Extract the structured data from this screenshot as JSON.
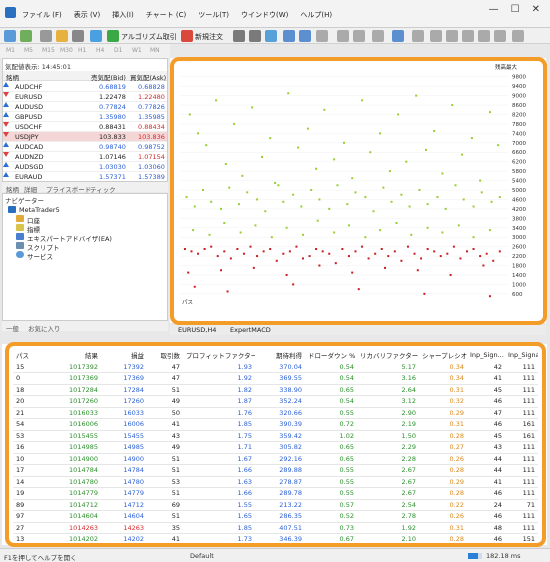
{
  "menu": [
    "ファイル (F)",
    "表示 (V)",
    "挿入(I)",
    "チャート (C)",
    "ツール(T)",
    "ウインドウ(W)",
    "ヘルプ(H)"
  ],
  "toolbar": {
    "algo_label": "アルゴリズム取引",
    "new_order_label": "新規注文"
  },
  "timeframes": [
    "M1",
    "M5",
    "M15",
    "M30",
    "H1",
    "H4",
    "D1",
    "W1",
    "MN"
  ],
  "market_watch": {
    "title": "気配値表示: 14:45:01",
    "headers": {
      "symbol": "銘柄",
      "bid": "売気配(Bid)",
      "ask": "買気配(Ask)"
    },
    "rows": [
      {
        "symbol": "AUDCHF",
        "bid": "0.68819",
        "ask": "0.68828",
        "dir": "up"
      },
      {
        "symbol": "EURUSD",
        "bid": "1.22478",
        "ask": "1.22480",
        "dir": "dn"
      },
      {
        "symbol": "AUDUSD",
        "bid": "0.77824",
        "ask": "0.77826",
        "dir": "up"
      },
      {
        "symbol": "GBPUSD",
        "bid": "1.35980",
        "ask": "1.35985",
        "dir": "up"
      },
      {
        "symbol": "USDCHF",
        "bid": "0.88431",
        "ask": "0.88434",
        "dir": "dn"
      },
      {
        "symbol": "USDJPY",
        "bid": "103.833",
        "ask": "103.836",
        "dir": "dn"
      },
      {
        "symbol": "AUDCAD",
        "bid": "0.98740",
        "ask": "0.98752",
        "dir": "up"
      },
      {
        "symbol": "AUDNZD",
        "bid": "1.07146",
        "ask": "1.07154",
        "dir": "dn"
      },
      {
        "symbol": "AUDSGD",
        "bid": "1.03030",
        "ask": "1.03060",
        "dir": "up"
      },
      {
        "symbol": "EURAUD",
        "bid": "1.57371",
        "ask": "1.57389",
        "dir": "up"
      }
    ],
    "tabs": [
      "銘柄",
      "詳細",
      "プライスボード",
      "ティック"
    ]
  },
  "navigator": {
    "title": "ナビゲーター",
    "items": [
      "MetaTrader5",
      "口座",
      "指標",
      "エキスパートアドバイザ(EA)",
      "スクリプト",
      "サービス"
    ],
    "tabs": [
      "一般",
      "お気に入り"
    ]
  },
  "chart": {
    "corner_label": "残高最大",
    "tabs": [
      "EURUSD,H4",
      "ExpertMACD"
    ]
  },
  "chart_data": {
    "type": "scatter",
    "title": "",
    "y_ticks": [
      "9800",
      "9400",
      "9000",
      "8600",
      "8200",
      "7800",
      "7400",
      "7000",
      "6600",
      "6200",
      "5800",
      "5400",
      "5000",
      "4600",
      "4200",
      "3800",
      "3400",
      "3000",
      "2600",
      "2200",
      "1800",
      "1400",
      "1000",
      "600"
    ],
    "ylim": [
      0,
      10000
    ],
    "x_label": "パス",
    "xlim": [
      0,
      1000
    ],
    "series": [
      {
        "color": "#9acd32",
        "x": [
          30,
          55,
          80,
          110,
          140,
          165,
          190,
          220,
          250,
          275,
          300,
          330,
          360,
          390,
          415,
          440,
          470,
          500,
          525,
          555,
          580,
          610,
          640,
          665,
          690,
          720,
          750,
          775,
          800,
          830,
          860,
          890,
          915,
          945,
          970,
          20,
          45,
          70,
          95,
          125,
          150,
          180,
          205,
          235,
          260,
          290,
          315,
          345,
          370,
          400,
          425,
          455,
          480,
          510,
          535,
          565,
          590,
          620,
          645,
          675,
          700,
          730,
          755,
          785,
          810,
          840,
          865,
          895,
          920,
          950,
          975,
          40,
          90,
          135,
          185,
          230,
          280,
          325,
          375,
          420,
          470,
          515,
          565,
          610,
          660,
          705,
          755,
          800,
          850,
          895,
          945
        ],
        "y": [
          8200,
          7400,
          6900,
          8800,
          6100,
          7800,
          5600,
          8500,
          6400,
          7200,
          5200,
          9100,
          6800,
          7600,
          5900,
          8400,
          6300,
          7000,
          5500,
          8800,
          6600,
          7400,
          5800,
          8200,
          6200,
          9000,
          6700,
          7500,
          5700,
          8600,
          6500,
          7200,
          5400,
          8300,
          6900,
          4700,
          4300,
          5000,
          4500,
          4200,
          5100,
          4400,
          4900,
          4600,
          4100,
          5300,
          4500,
          4800,
          4300,
          5000,
          4600,
          4200,
          5200,
          4400,
          4900,
          4700,
          4100,
          5100,
          4500,
          4800,
          4300,
          5000,
          4400,
          4700,
          4200,
          5200,
          4600,
          4300,
          4900,
          4500,
          4700,
          3300,
          3100,
          3600,
          3200,
          3500,
          3000,
          3400,
          3100,
          3700,
          3200,
          3500,
          3000,
          3300,
          3600,
          3100,
          3400,
          3200,
          3500,
          3000,
          3300
        ]
      },
      {
        "color": "#c81e1e",
        "x": [
          15,
          35,
          55,
          75,
          95,
          115,
          135,
          155,
          175,
          195,
          215,
          235,
          255,
          275,
          295,
          315,
          335,
          355,
          375,
          395,
          415,
          435,
          455,
          475,
          495,
          515,
          535,
          555,
          575,
          595,
          615,
          635,
          655,
          675,
          695,
          715,
          735,
          755,
          775,
          795,
          815,
          835,
          855,
          875,
          895,
          915,
          935,
          955,
          975,
          25,
          125,
          225,
          325,
          425,
          525,
          625,
          725,
          825,
          925,
          45,
          145,
          345,
          545,
          745,
          945
        ],
        "y": [
          2500,
          2400,
          2300,
          2500,
          2600,
          2200,
          2400,
          2100,
          2500,
          2300,
          2600,
          2200,
          2400,
          2500,
          2000,
          2300,
          2400,
          2600,
          2100,
          2200,
          2500,
          2400,
          2300,
          1900,
          2500,
          2200,
          2400,
          2600,
          2100,
          2300,
          2500,
          2200,
          2400,
          2000,
          2600,
          2300,
          2100,
          2500,
          2400,
          2200,
          2300,
          2600,
          2100,
          2400,
          2500,
          2200,
          2300,
          2000,
          2400,
          1500,
          1600,
          1700,
          1400,
          1800,
          1500,
          1700,
          1600,
          1400,
          1800,
          900,
          700,
          1000,
          800,
          600,
          500
        ]
      }
    ]
  },
  "results": {
    "headers": [
      "パス",
      "結果",
      "損益",
      "取引数",
      "プロフィットファクター",
      "期待利得",
      "ドローダウン %",
      "リカバリファクター",
      "シャープレシオ",
      "Inp_Sign...",
      "Inp_Signal_MA..."
    ],
    "rows": [
      [
        "15",
        "1017392",
        "17392",
        "47",
        "1.93",
        "370.04",
        "0.54",
        "5.17",
        "0.34",
        "42",
        "111"
      ],
      [
        "0",
        "1017369",
        "17369",
        "47",
        "1.92",
        "369.55",
        "0.54",
        "3.16",
        "0.34",
        "41",
        "111"
      ],
      [
        "18",
        "1017284",
        "17284",
        "51",
        "1.82",
        "338.90",
        "0.65",
        "2.64",
        "0.31",
        "45",
        "111"
      ],
      [
        "20",
        "1017260",
        "17260",
        "49",
        "1.87",
        "352.24",
        "0.54",
        "3.12",
        "0.32",
        "46",
        "111"
      ],
      [
        "21",
        "1016033",
        "16033",
        "50",
        "1.76",
        "320.66",
        "0.55",
        "2.90",
        "0.29",
        "47",
        "111"
      ],
      [
        "54",
        "1016006",
        "16006",
        "41",
        "1.85",
        "390.39",
        "0.72",
        "2.19",
        "0.31",
        "46",
        "161"
      ],
      [
        "53",
        "1015455",
        "15455",
        "43",
        "1.75",
        "359.42",
        "1.02",
        "1.50",
        "0.28",
        "45",
        "161"
      ],
      [
        "16",
        "1014985",
        "14985",
        "49",
        "1.71",
        "305.82",
        "0.65",
        "2.29",
        "0.27",
        "43",
        "111"
      ],
      [
        "10",
        "1014900",
        "14900",
        "51",
        "1.67",
        "292.16",
        "0.65",
        "2.28",
        "0.26",
        "44",
        "111"
      ],
      [
        "17",
        "1014784",
        "14784",
        "51",
        "1.66",
        "289.88",
        "0.55",
        "2.67",
        "0.28",
        "44",
        "111"
      ],
      [
        "14",
        "1014780",
        "14780",
        "53",
        "1.63",
        "278.87",
        "0.55",
        "2.67",
        "0.29",
        "41",
        "111"
      ],
      [
        "19",
        "1014779",
        "14779",
        "51",
        "1.66",
        "289.78",
        "0.55",
        "2.67",
        "0.28",
        "46",
        "111"
      ],
      [
        "89",
        "1014712",
        "14712",
        "69",
        "1.55",
        "213.22",
        "0.57",
        "2.54",
        "0.22",
        "24",
        "71"
      ],
      [
        "97",
        "1014604",
        "14604",
        "51",
        "1.65",
        "286.35",
        "0.52",
        "2.78",
        "0.26",
        "46",
        "111"
      ],
      [
        "27",
        "1014263",
        "14263",
        "35",
        "1.85",
        "407.51",
        "0.73",
        "1.92",
        "0.31",
        "48",
        "111"
      ],
      [
        "13",
        "1014202",
        "14202",
        "41",
        "1.73",
        "346.39",
        "0.67",
        "2.10",
        "0.28",
        "46",
        "151"
      ]
    ]
  },
  "status": {
    "help": "F1を押してヘルプを開く",
    "profile": "Default",
    "traffic": "182.18 ms"
  }
}
